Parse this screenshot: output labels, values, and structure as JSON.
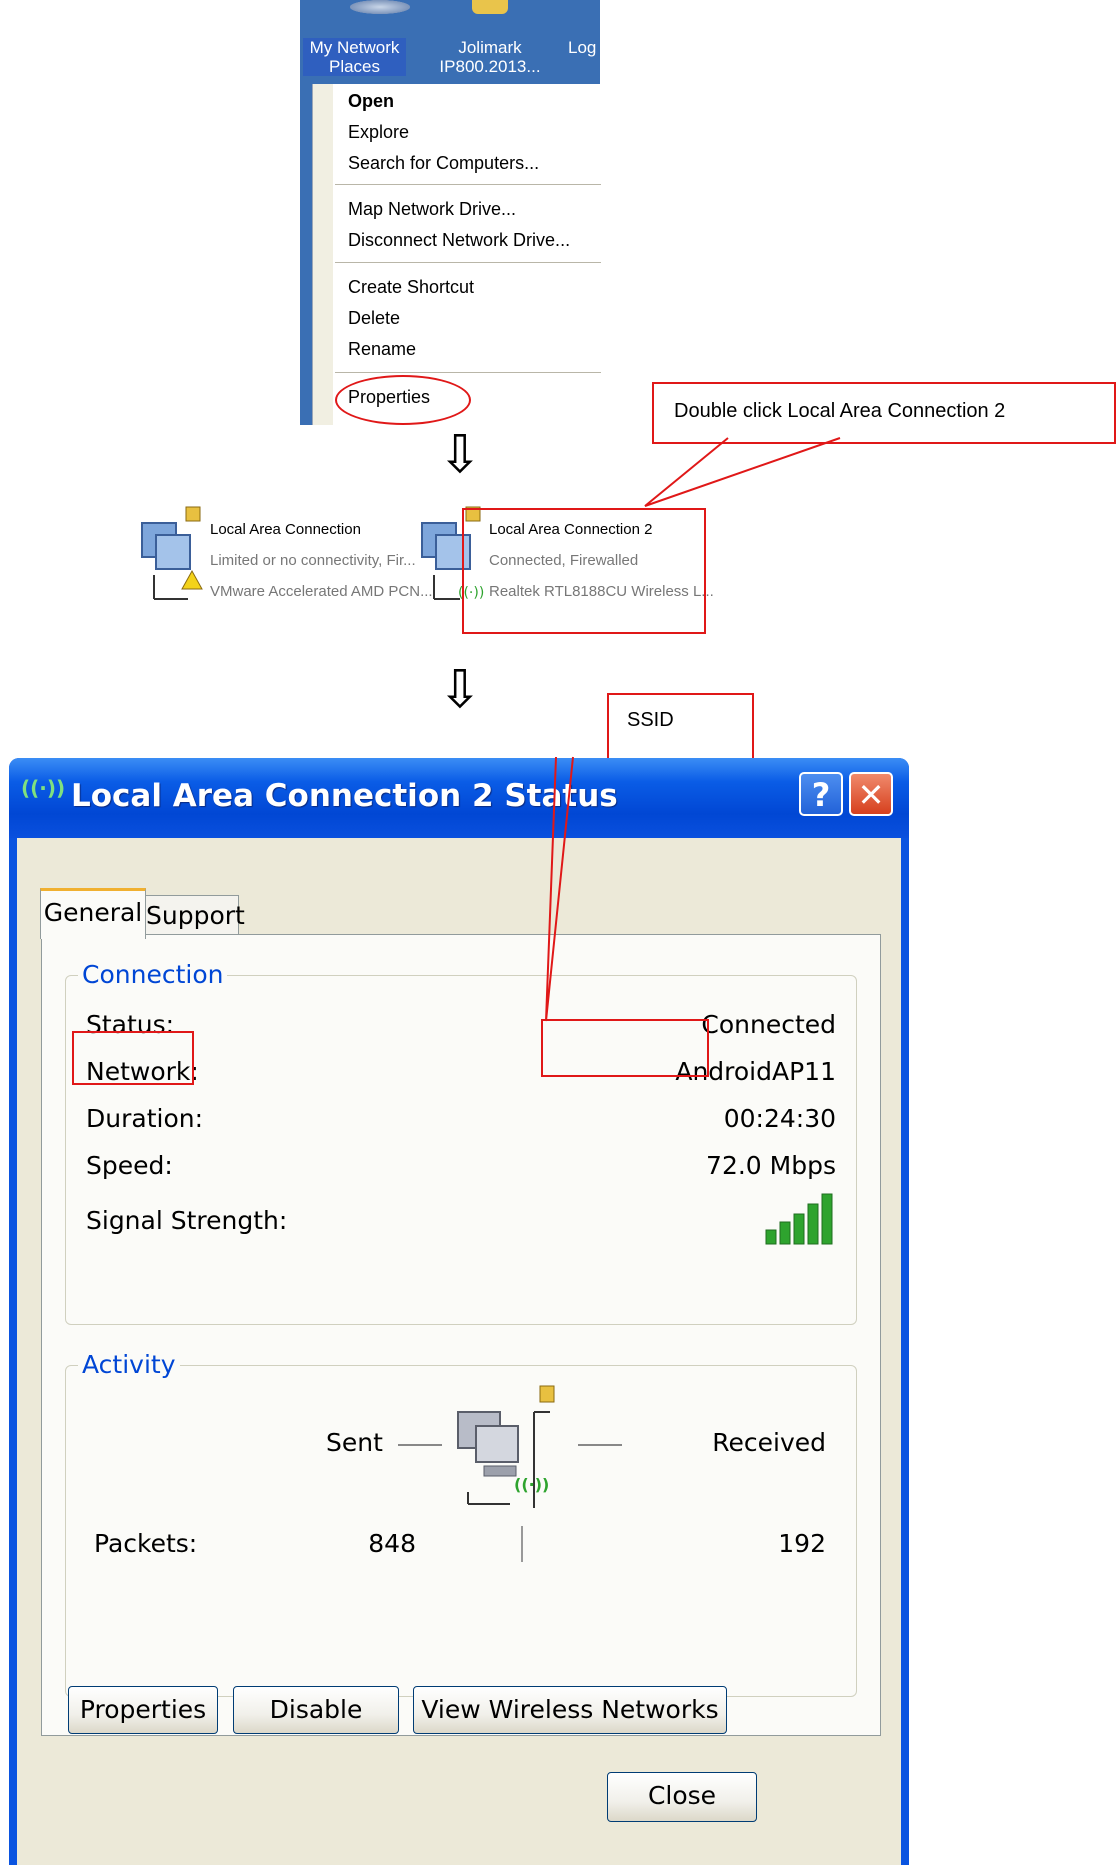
{
  "desktop": {
    "icons": [
      {
        "label_line1": "My Network",
        "label_line2": "Places"
      },
      {
        "label_line1": "Jolimark",
        "label_line2": "IP800.2013..."
      },
      {
        "label_line1": "Log",
        "label_line2": ""
      }
    ]
  },
  "context_menu": {
    "items": [
      "Open",
      "Explore",
      "Search for Computers...",
      "Map Network Drive...",
      "Disconnect Network Drive...",
      "Create Shortcut",
      "Delete",
      "Rename",
      "Properties"
    ]
  },
  "callouts": {
    "double_click": "Double click Local Area Connection 2",
    "ssid": "SSID"
  },
  "connections": [
    {
      "name": "Local Area Connection",
      "status": "Limited or no connectivity, Fir...",
      "device": "VMware Accelerated AMD PCN..."
    },
    {
      "name": "Local Area Connection 2",
      "status": "Connected, Firewalled",
      "device": "Realtek RTL8188CU Wireless L..."
    }
  ],
  "arrows": {
    "glyph": "⇩"
  },
  "dialog": {
    "title": "Local Area Connection 2 Status",
    "help": "?",
    "close_x": "✕",
    "tabs": [
      "General",
      "Support"
    ],
    "connection_group": {
      "label": "Connection",
      "rows": [
        {
          "label": "Status:",
          "value": "Connected"
        },
        {
          "label": "Network:",
          "value": "AndroidAP11"
        },
        {
          "label": "Duration:",
          "value": "00:24:30"
        },
        {
          "label": "Speed:",
          "value": "72.0 Mbps"
        },
        {
          "label": "Signal Strength:",
          "value": ""
        }
      ],
      "signal_bars_lit": 5,
      "signal_bars_total": 5
    },
    "activity_group": {
      "label": "Activity",
      "sent_label": "Sent",
      "received_label": "Received",
      "packets_label": "Packets:",
      "packets_sent": "848",
      "packets_received": "192"
    },
    "buttons": [
      "Properties",
      "Disable",
      "View Wireless Networks"
    ],
    "close_button": "Close",
    "colors": {
      "title_blue": "#0147d4",
      "accent_green": "#2ea32e",
      "red_highlight": "#e01818"
    }
  }
}
